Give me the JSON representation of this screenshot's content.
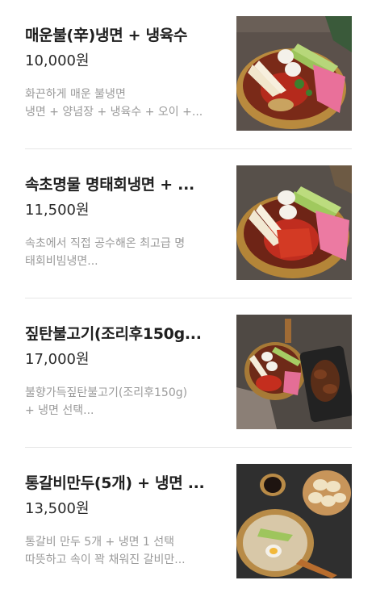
{
  "menu": {
    "items": [
      {
        "name": "매운불(辛)냉면 + 냉육수",
        "price": "10,000원",
        "desc_line1": "화끈하게 매운 불냉면",
        "desc_line2": "냉면 + 양념장 + 냉육수 + 오이 +...",
        "image_icon": "spicy-cold-noodle-photo"
      },
      {
        "name": "속초명물 명태회냉면 + ...",
        "price": "11,500원",
        "desc_line1": "속초에서 직접 공수해온 최고급 명",
        "desc_line2": "태회비빔냉면...",
        "image_icon": "pollock-cold-noodle-photo"
      },
      {
        "name": "짚탄불고기(조리후150g...",
        "price": "17,000원",
        "desc_line1": "불향가득짚탄불고기(조리후150g)",
        "desc_line2": "+ 냉면 선택...",
        "image_icon": "bulgogi-and-noodle-photo"
      },
      {
        "name": "통갈비만두(5개) + 냉면 ...",
        "price": "13,500원",
        "desc_line1": "통갈비 만두 5개 + 냉면 1 선택",
        "desc_line2": "따뜻하고 속이 꽉 채워진 갈비만...",
        "image_icon": "dumpling-and-noodle-photo"
      }
    ]
  }
}
